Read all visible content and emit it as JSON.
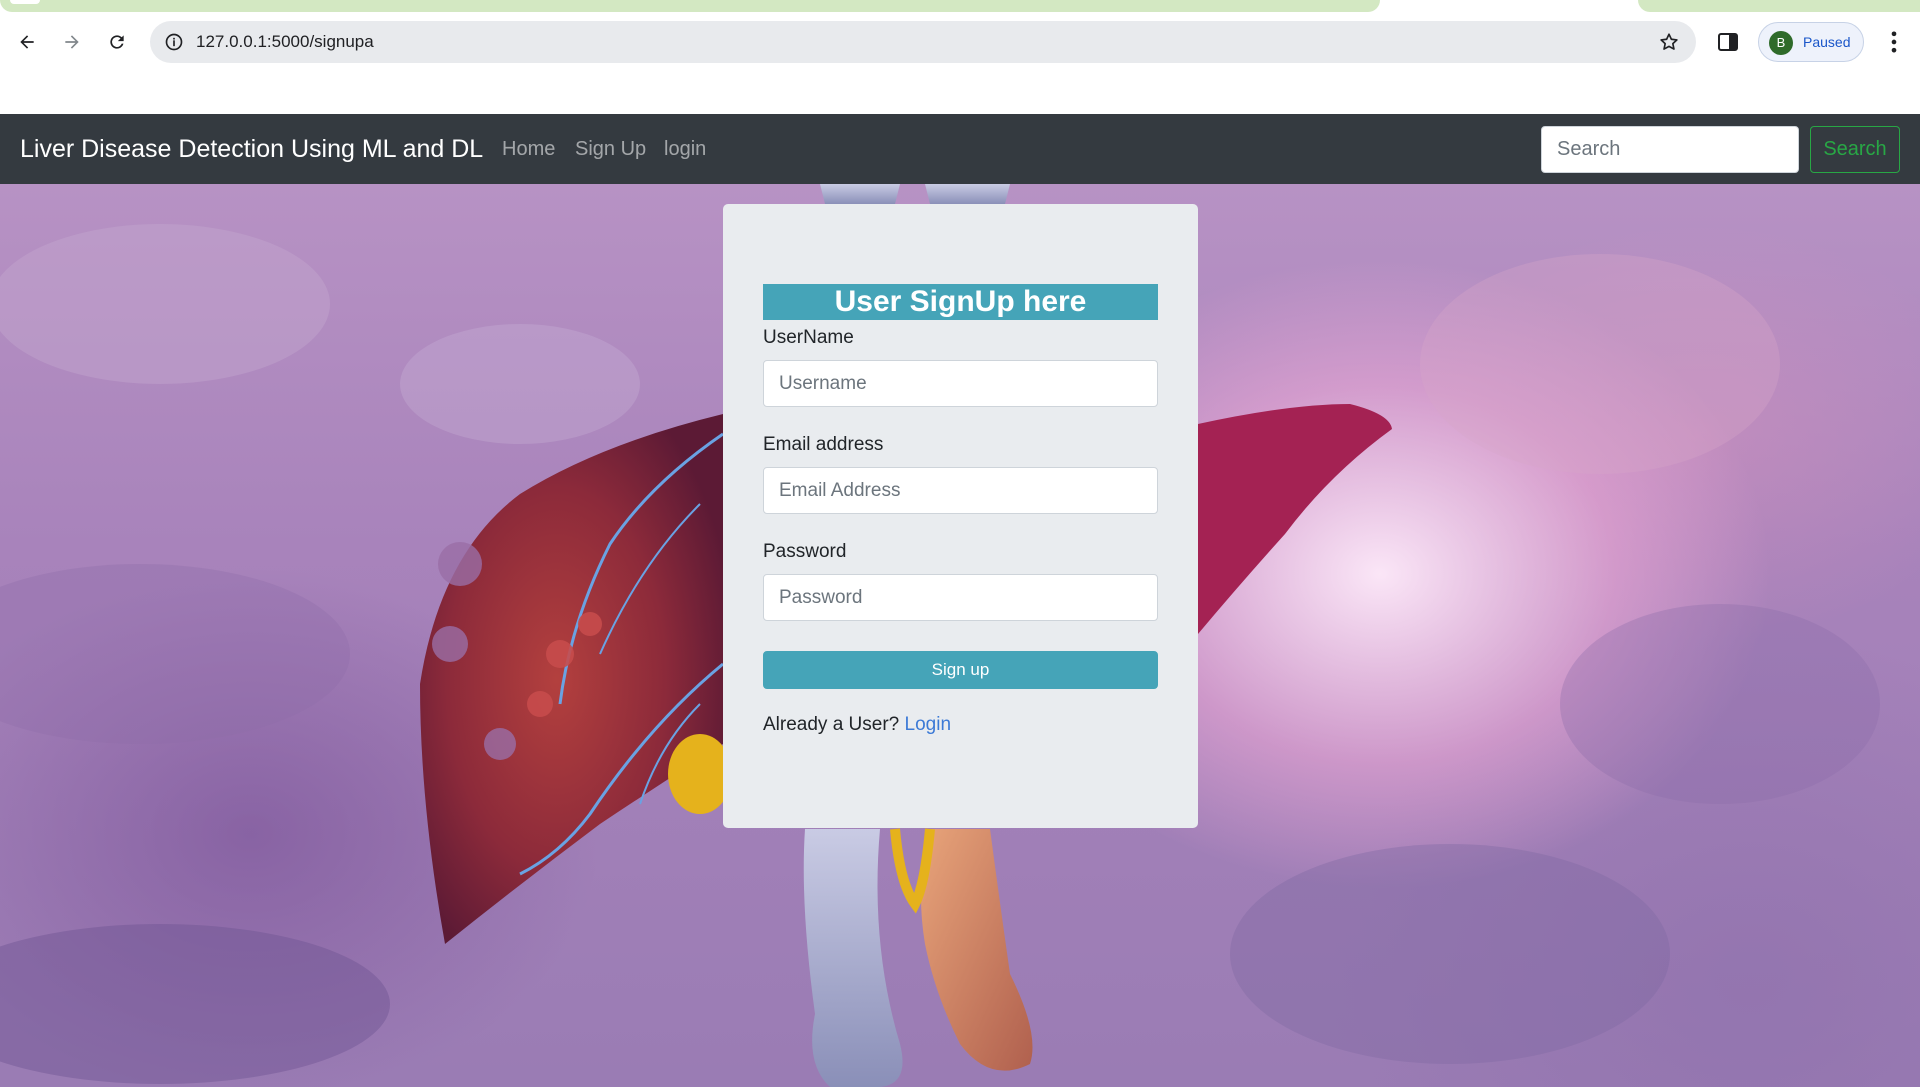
{
  "browser": {
    "url": "127.0.0.1:5000/signupa",
    "profile_initial": "B",
    "profile_status": "Paused"
  },
  "navbar": {
    "brand": "Liver Disease Detection Using ML and DL",
    "links": [
      "Home",
      "Sign Up",
      "login"
    ],
    "search_placeholder": "Search",
    "search_button": "Search"
  },
  "form": {
    "title": "User SignUp here",
    "username_label": "UserName",
    "username_placeholder": "Username",
    "email_label": "Email address",
    "email_placeholder": "Email Address",
    "password_label": "Password",
    "password_placeholder": "Password",
    "submit_label": "Sign up",
    "already_text": "Already a User?",
    "login_link": "Login"
  },
  "colors": {
    "navbar_bg": "#343a40",
    "accent": "#45a4b8",
    "search_button": "#28a745",
    "link": "#3c7ad6",
    "card_bg": "#e9ecef"
  }
}
